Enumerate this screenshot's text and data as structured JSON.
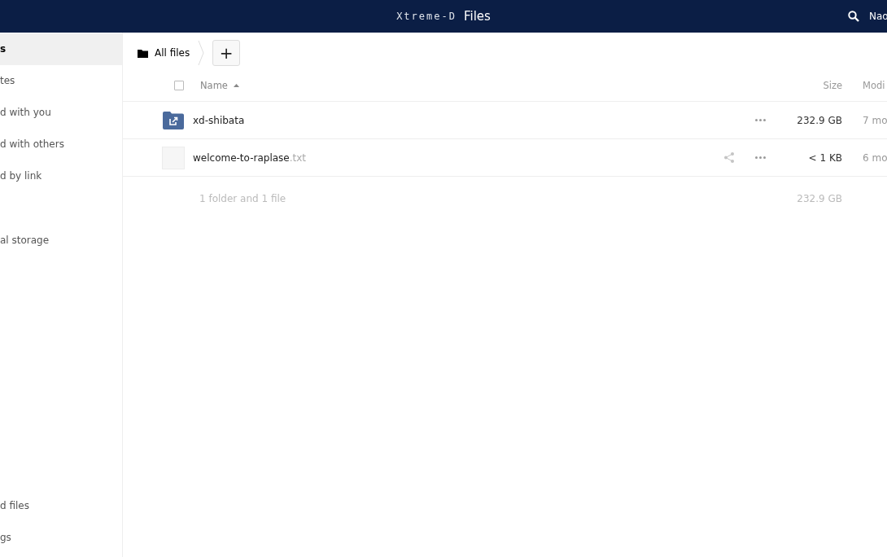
{
  "header": {
    "logo": "Xtreme-D",
    "app_title": "Files",
    "user": "Nao"
  },
  "sidebar": {
    "items": [
      {
        "label": "s",
        "selected": true
      },
      {
        "label": "tes",
        "selected": false
      },
      {
        "label": "d with you",
        "selected": false
      },
      {
        "label": "d with others",
        "selected": false
      },
      {
        "label": "d by link",
        "selected": false
      },
      {
        "label": "al storage",
        "selected": false
      }
    ],
    "bottom_items": [
      {
        "label": "d files"
      },
      {
        "label": "gs"
      }
    ]
  },
  "breadcrumb": {
    "label": "All files",
    "new_button": "+"
  },
  "table": {
    "select_all": {
      "checked": false
    },
    "columns": [
      {
        "label": "Name",
        "sorted": true
      },
      {
        "label": "Size",
        "sorted": false
      },
      {
        "label": "Modi",
        "sorted": false
      }
    ],
    "rows": [
      {
        "kind": "shared-folder",
        "name": "xd-shibata",
        "extension": "",
        "shareable": false,
        "size": "232.9 GB",
        "modified": "7 mo"
      },
      {
        "kind": "file",
        "name": "welcome-to-raplase",
        "extension": ".txt",
        "shareable": true,
        "size": "< 1 KB",
        "modified": "6 mo"
      }
    ],
    "summary": {
      "label": "1 folder and 1 file",
      "size": "232.9 GB"
    }
  }
}
